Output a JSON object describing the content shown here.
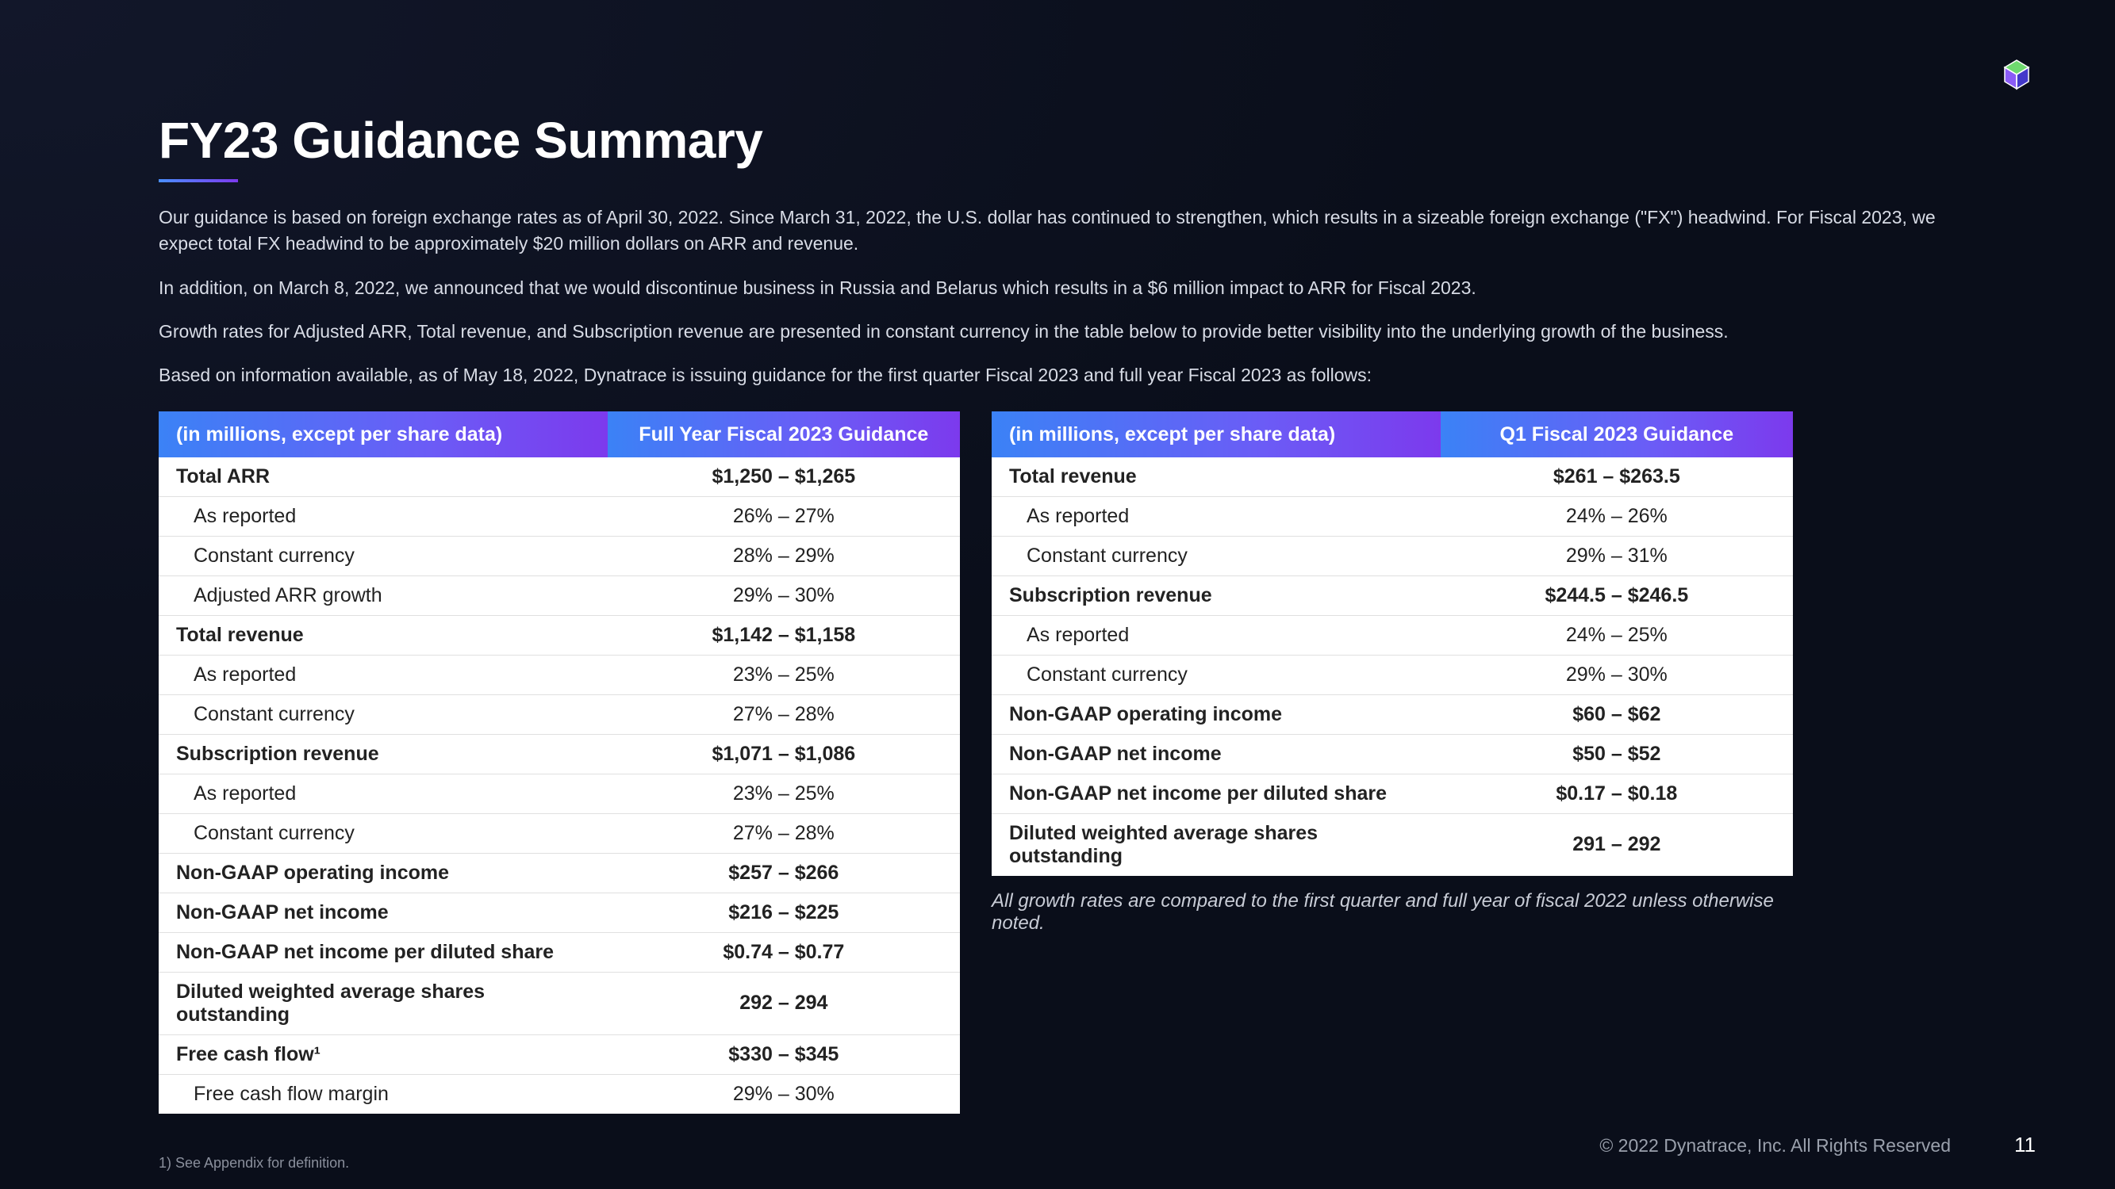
{
  "title": "FY23 Guidance Summary",
  "intro": {
    "p1": "Our guidance is based on foreign exchange rates as of April 30, 2022. Since March 31, 2022, the U.S. dollar has continued to strengthen, which results in a sizeable foreign exchange (\"FX\") headwind. For Fiscal 2023, we expect total FX headwind to be approximately $20 million dollars on ARR and revenue.",
    "p2": "In addition, on March 8, 2022, we announced that we would discontinue business in Russia and Belarus which results in a $6 million impact to ARR for Fiscal 2023.",
    "p3": "Growth rates for Adjusted ARR, Total revenue, and Subscription revenue are presented in constant currency in the table below to provide better visibility into the underlying growth of the business.",
    "p4": "Based on information available, as of May 18, 2022, Dynatrace is issuing guidance for the first quarter Fiscal 2023 and full year Fiscal 2023 as follows:"
  },
  "table_left": {
    "header_left": "(in millions, except per share data)",
    "header_right": "Full Year Fiscal 2023 Guidance",
    "rows": [
      {
        "label": "Total ARR",
        "value": "$1,250 – $1,265",
        "bold": true
      },
      {
        "label": "As reported",
        "value": "26% – 27%",
        "sub": true
      },
      {
        "label": "Constant currency",
        "value": "28% – 29%",
        "sub": true
      },
      {
        "label": "Adjusted ARR growth",
        "value": "29% – 30%",
        "sub": true
      },
      {
        "label": "Total revenue",
        "value": "$1,142 – $1,158",
        "bold": true
      },
      {
        "label": "As reported",
        "value": "23% – 25%",
        "sub": true
      },
      {
        "label": "Constant currency",
        "value": "27% – 28%",
        "sub": true
      },
      {
        "label": "Subscription revenue",
        "value": "$1,071 – $1,086",
        "bold": true
      },
      {
        "label": "As reported",
        "value": "23% – 25%",
        "sub": true
      },
      {
        "label": "Constant currency",
        "value": "27% – 28%",
        "sub": true
      },
      {
        "label": "Non-GAAP operating income",
        "value": "$257 – $266",
        "bold": true
      },
      {
        "label": "Non-GAAP net income",
        "value": "$216 – $225",
        "bold": true
      },
      {
        "label": "Non-GAAP net income per diluted share",
        "value": "$0.74 – $0.77",
        "bold": true
      },
      {
        "label": "Diluted weighted average shares outstanding",
        "value": "292 – 294",
        "bold": true
      },
      {
        "label": "Free cash flow¹",
        "value": "$330 – $345",
        "bold": true
      },
      {
        "label": "Free cash flow margin",
        "value": "29% – 30%",
        "sub": true
      }
    ]
  },
  "table_right": {
    "header_left": "(in millions, except per share data)",
    "header_right": "Q1 Fiscal 2023 Guidance",
    "rows": [
      {
        "label": "Total revenue",
        "value": "$261 – $263.5",
        "bold": true
      },
      {
        "label": "As reported",
        "value": "24% – 26%",
        "sub": true
      },
      {
        "label": "Constant currency",
        "value": "29% – 31%",
        "sub": true
      },
      {
        "label": "Subscription revenue",
        "value": "$244.5 – $246.5",
        "bold": true
      },
      {
        "label": "As reported",
        "value": "24% – 25%",
        "sub": true
      },
      {
        "label": "Constant currency",
        "value": "29% – 30%",
        "sub": true
      },
      {
        "label": "Non-GAAP operating income",
        "value": "$60 – $62",
        "bold": true
      },
      {
        "label": "Non-GAAP net income",
        "value": "$50 – $52",
        "bold": true
      },
      {
        "label": "Non-GAAP net income per diluted share",
        "value": "$0.17 – $0.18",
        "bold": true
      },
      {
        "label": "Diluted weighted average shares outstanding",
        "value": "291 – 292",
        "bold": true
      }
    ]
  },
  "growth_note": "All growth rates are compared to the first quarter and full year of fiscal 2022 unless otherwise noted.",
  "appendix_note": "1)      See Appendix for definition.",
  "copyright": "© 2022 Dynatrace, Inc. All Rights Reserved",
  "page_number": "11"
}
